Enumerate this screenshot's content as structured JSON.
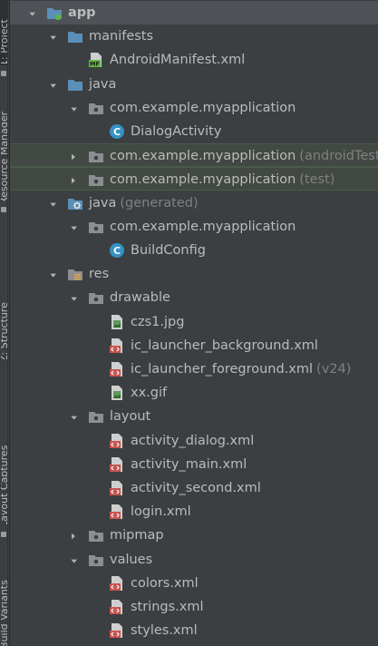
{
  "sidebar_tabs": [
    {
      "label": "1: Project"
    },
    {
      "label": "Resource Manager"
    },
    {
      "label": "Z: Structure"
    },
    {
      "label": "Layout Captures"
    },
    {
      "label": "Build Variants"
    }
  ],
  "tree": {
    "rows": [
      {
        "label": "app",
        "suffix": "",
        "icon": "module-folder-icon",
        "arrow": "expanded"
      },
      {
        "label": "manifests",
        "suffix": "",
        "icon": "folder-icon",
        "arrow": "expanded"
      },
      {
        "label": "AndroidManifest.xml",
        "suffix": "",
        "icon": "manifest-file-icon",
        "arrow": "none"
      },
      {
        "label": "java",
        "suffix": "",
        "icon": "source-folder-icon",
        "arrow": "expanded"
      },
      {
        "label": "com.example.myapplication",
        "suffix": "",
        "icon": "package-icon",
        "arrow": "expanded"
      },
      {
        "label": "DialogActivity",
        "suffix": "",
        "icon": "class-icon",
        "arrow": "none"
      },
      {
        "label": "com.example.myapplication",
        "suffix": "(androidTest)",
        "icon": "package-icon",
        "arrow": "collapsed"
      },
      {
        "label": "com.example.myapplication",
        "suffix": "(test)",
        "icon": "package-icon",
        "arrow": "collapsed"
      },
      {
        "label": "java",
        "suffix": "(generated)",
        "icon": "generated-source-folder-icon",
        "arrow": "expanded"
      },
      {
        "label": "com.example.myapplication",
        "suffix": "",
        "icon": "package-icon",
        "arrow": "expanded"
      },
      {
        "label": "BuildConfig",
        "suffix": "",
        "icon": "class-icon",
        "arrow": "none"
      },
      {
        "label": "res",
        "suffix": "",
        "icon": "resource-folder-icon",
        "arrow": "expanded"
      },
      {
        "label": "drawable",
        "suffix": "",
        "icon": "package-icon",
        "arrow": "expanded"
      },
      {
        "label": "czs1.jpg",
        "suffix": "",
        "icon": "image-file-icon",
        "arrow": "none"
      },
      {
        "label": "ic_launcher_background.xml",
        "suffix": "",
        "icon": "xml-file-icon",
        "arrow": "none"
      },
      {
        "label": "ic_launcher_foreground.xml",
        "suffix": "(v24)",
        "icon": "xml-file-icon",
        "arrow": "none"
      },
      {
        "label": "xx.gif",
        "suffix": "",
        "icon": "image-file-icon",
        "arrow": "none"
      },
      {
        "label": "layout",
        "suffix": "",
        "icon": "package-icon",
        "arrow": "expanded"
      },
      {
        "label": "activity_dialog.xml",
        "suffix": "",
        "icon": "xml-file-icon",
        "arrow": "none"
      },
      {
        "label": "activity_main.xml",
        "suffix": "",
        "icon": "xml-file-icon",
        "arrow": "none"
      },
      {
        "label": "activity_second.xml",
        "suffix": "",
        "icon": "xml-file-icon",
        "arrow": "none"
      },
      {
        "label": "login.xml",
        "suffix": "",
        "icon": "xml-file-icon",
        "arrow": "none"
      },
      {
        "label": "mipmap",
        "suffix": "",
        "icon": "package-icon",
        "arrow": "collapsed"
      },
      {
        "label": "values",
        "suffix": "",
        "icon": "package-icon",
        "arrow": "expanded"
      },
      {
        "label": "colors.xml",
        "suffix": "",
        "icon": "xml-file-icon",
        "arrow": "none"
      },
      {
        "label": "strings.xml",
        "suffix": "",
        "icon": "xml-file-icon",
        "arrow": "none"
      },
      {
        "label": "styles.xml",
        "suffix": "",
        "icon": "xml-file-icon",
        "arrow": "none"
      }
    ]
  },
  "colors": {
    "background": "#3c3f41",
    "text": "#bbbbbb",
    "suffix_text": "#808080",
    "folder_blue": "#5a8fb8",
    "highlight_row": "#424842",
    "class_icon": "#3592c4",
    "xml_icon": "#c75450",
    "manifest_icon": "#62b543"
  }
}
